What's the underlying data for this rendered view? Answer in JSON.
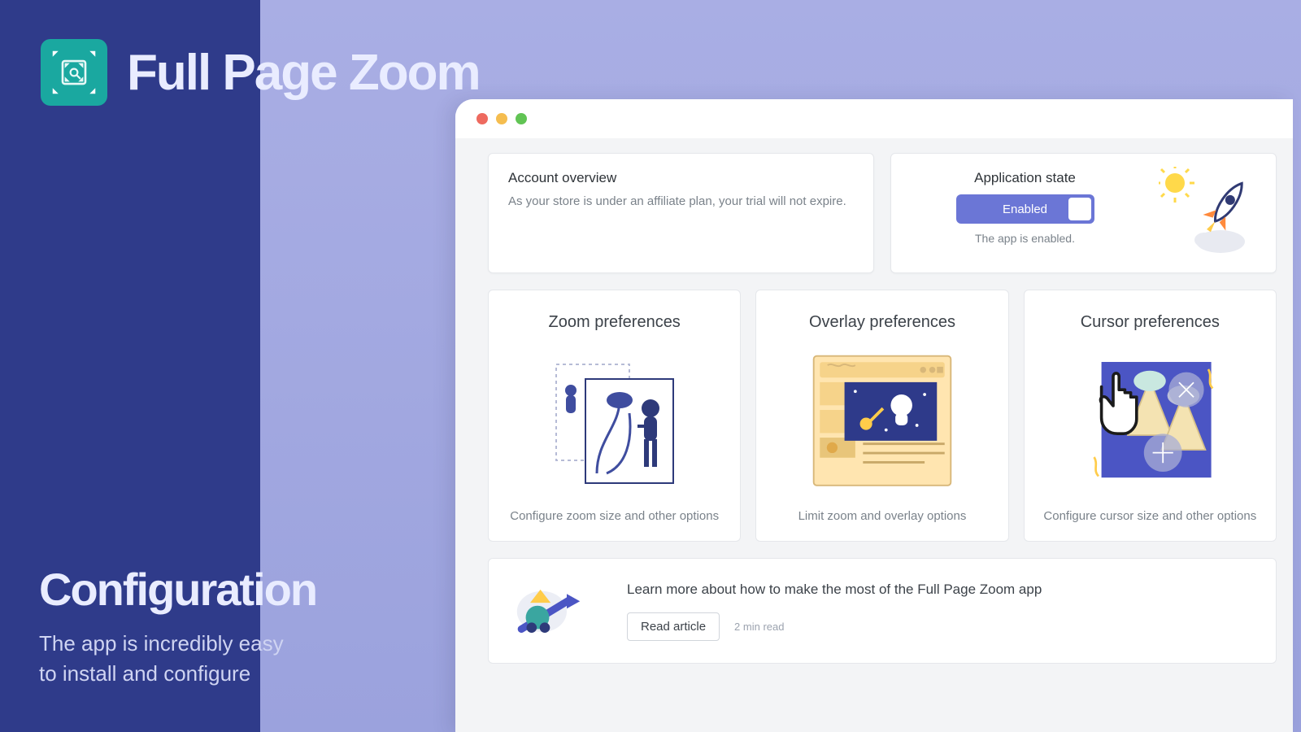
{
  "brand": {
    "product_name": "Full Page Zoom"
  },
  "caption": {
    "heading": "Configuration",
    "line1": "The app is incredibly easy",
    "line2": "to install and configure"
  },
  "account": {
    "title": "Account overview",
    "subtitle": "As your store is under an affiliate plan, your trial will not expire."
  },
  "state": {
    "title": "Application state",
    "toggle_label": "Enabled",
    "status_text": "The app is enabled."
  },
  "prefs": [
    {
      "title": "Zoom preferences",
      "subtitle": "Configure zoom size and other options"
    },
    {
      "title": "Overlay preferences",
      "subtitle": "Limit zoom and overlay options"
    },
    {
      "title": "Cursor preferences",
      "subtitle": "Configure cursor size and other options"
    }
  ],
  "learn": {
    "title": "Learn more about how to make the most of the Full Page Zoom app",
    "button": "Read article",
    "read_time": "2 min read"
  },
  "icon_names": {
    "logo": "zoom-expand-icon",
    "rocket": "rocket-launch-icon",
    "sun": "sun-icon",
    "cursor_hand": "hand-cursor-icon"
  }
}
